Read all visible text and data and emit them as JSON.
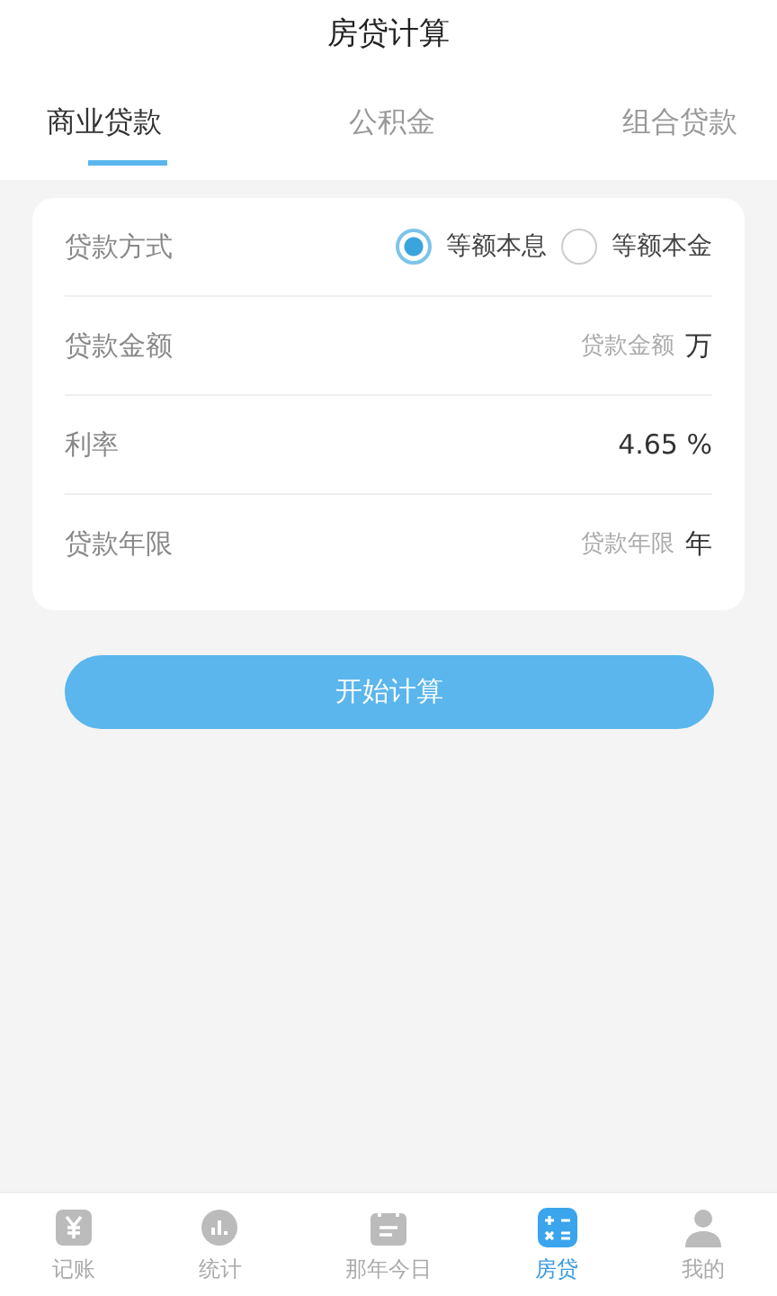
{
  "title": "房贷计算",
  "tabs": [
    {
      "label": "商业贷款",
      "selected": true
    },
    {
      "label": "公积金",
      "selected": false
    },
    {
      "label": "组合贷款",
      "selected": false
    }
  ],
  "form": [
    {
      "kind": "radio",
      "label": "贷款方式",
      "options": [
        {
          "label": "等额本息",
          "selected": true
        },
        {
          "label": "等额本金",
          "selected": false
        }
      ]
    },
    {
      "kind": "input",
      "label": "贷款金额",
      "placeholder": "贷款金额",
      "unit": "万"
    },
    {
      "kind": "value",
      "label": "利率",
      "value": "4.65 %"
    },
    {
      "kind": "input",
      "label": "贷款年限",
      "placeholder": "贷款年限",
      "unit": "年"
    }
  ],
  "button": "开始计算",
  "nav": [
    {
      "label": "记账",
      "kind": "yen",
      "selected": false
    },
    {
      "label": "统计",
      "kind": "chart",
      "selected": false
    },
    {
      "label": "那年今日",
      "kind": "calendar",
      "selected": false
    },
    {
      "label": "房贷",
      "kind": "calculator",
      "selected": true
    },
    {
      "label": "我的",
      "kind": "person",
      "selected": false
    }
  ]
}
